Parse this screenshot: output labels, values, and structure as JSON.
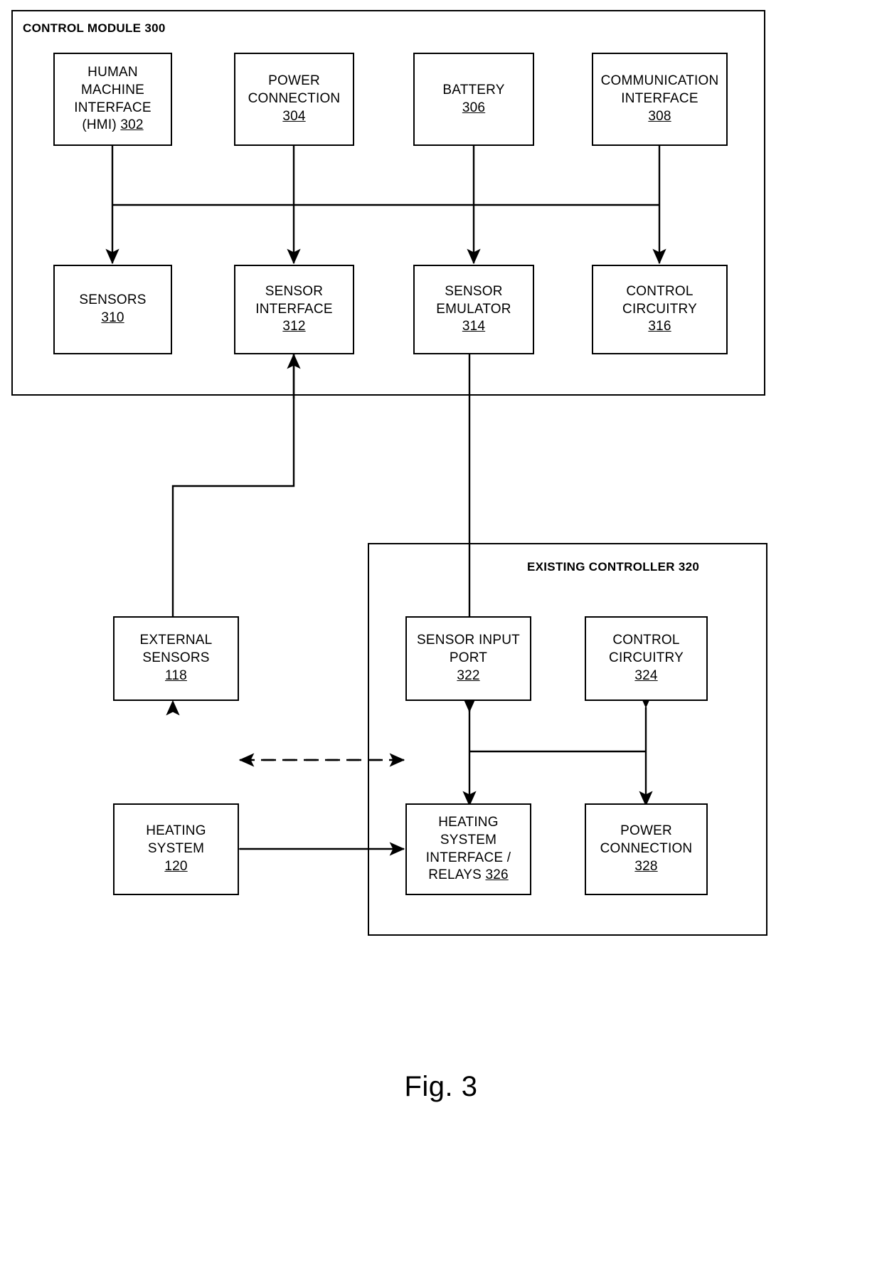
{
  "figure": {
    "caption": "Fig. 3"
  },
  "containers": [
    {
      "label": "CONTROL MODULE 300"
    },
    {
      "label": "EXISTING CONTROLLER 320"
    }
  ],
  "blocks": {
    "hmi": {
      "line1": "HUMAN",
      "line2": "MACHINE",
      "line3": "INTERFACE",
      "line4": "(HMI) ",
      "ref": "302"
    },
    "power_connection": {
      "line1": "POWER",
      "line2": "CONNECTION",
      "ref": "304"
    },
    "battery": {
      "line1": "BATTERY",
      "ref": "306"
    },
    "communication": {
      "line1": "COMMUNICATION",
      "line2": "INTERFACE",
      "ref": "308"
    },
    "sensors": {
      "line1": "SENSORS",
      "ref": "310"
    },
    "sensor_interface": {
      "line1": "SENSOR",
      "line2": "INTERFACE",
      "ref": "312"
    },
    "sensor_emulator": {
      "line1": "SENSOR",
      "line2": "EMULATOR",
      "ref": "314"
    },
    "control_circuitry": {
      "line1": "CONTROL",
      "line2": "CIRCUITRY",
      "ref": "316"
    },
    "external_sensors": {
      "line1": "EXTERNAL",
      "line2": "SENSORS",
      "ref": "118"
    },
    "sensor_input_port": {
      "line1": "SENSOR INPUT",
      "line2": "PORT",
      "ref": "322"
    },
    "control_circuitry_2": {
      "line1": "CONTROL",
      "line2": "CIRCUITRY",
      "ref": "324"
    },
    "heating_system": {
      "line1": "HEATING",
      "line2": "SYSTEM",
      "ref": "120"
    },
    "heating_interface": {
      "line1": "HEATING",
      "line2": "SYSTEM",
      "line3": "INTERFACE /",
      "line4": "RELAYS ",
      "ref": "326"
    },
    "power_connection_2": {
      "line1": "POWER",
      "line2": "CONNECTION",
      "ref": "328"
    }
  },
  "colors": {
    "stroke": "#000000",
    "background": "#ffffff"
  }
}
